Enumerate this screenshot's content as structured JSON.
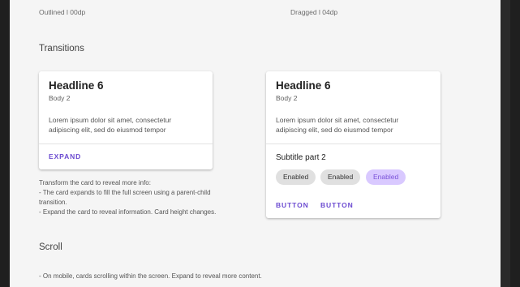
{
  "top_labels": {
    "left": "Outlined l 00dp",
    "right": "Dragged l 04dp"
  },
  "sections": {
    "transitions": "Transitions",
    "scroll": "Scroll"
  },
  "card_left": {
    "headline": "Headline 6",
    "subhead": "Body 2",
    "body": "Lorem ipsum dolor sit amet, consectetur adipiscing elit, sed do eiusmod tempor",
    "action": "EXPAND"
  },
  "card_right": {
    "headline": "Headline 6",
    "subhead": "Body 2",
    "body": "Lorem ipsum dolor sit amet, consectetur adipiscing elit, sed do eiusmod tempor",
    "subtitle": "Subtitle part 2",
    "chips": [
      {
        "label": "Enabled",
        "state": "default"
      },
      {
        "label": "Enabled",
        "state": "default"
      },
      {
        "label": "Enabled",
        "state": "selected"
      }
    ],
    "buttons": [
      "BUTTON",
      "BUTTON"
    ]
  },
  "transition_notes": [
    "Transform the card to reveal more info:",
    "- The card expands to fill the full screen using a parent-child",
    "transition.",
    "- Expand the card to reveal information. Card height changes."
  ],
  "scroll_notes": [
    "- On mobile, cards scrolling within the screen. Expand to reveal more content."
  ],
  "colors": {
    "accent": "#6c4bd1",
    "chip_selected_bg": "#d9c9ff",
    "background": "#f5f5f5",
    "outer_background": "#1f1f1f"
  }
}
